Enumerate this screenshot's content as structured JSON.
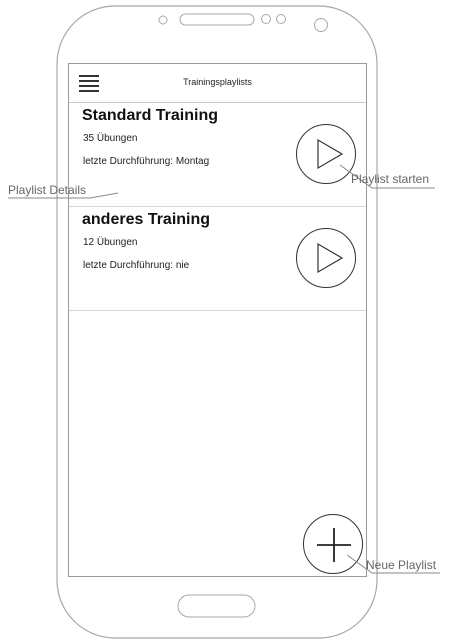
{
  "appbar": {
    "title": "Trainingsplaylists",
    "menu_icon": "hamburger-menu-icon"
  },
  "playlists": [
    {
      "title": "Standard Training",
      "count": "35 Übungen",
      "last_run": "letzte Durchführung: Montag",
      "play_icon": "play-icon"
    },
    {
      "title": "anderes Training",
      "count": "12 Übungen",
      "last_run": "letzte Durchführung: nie",
      "play_icon": "play-icon"
    }
  ],
  "fab": {
    "icon": "plus-icon"
  },
  "annotations": {
    "details": "Playlist Details",
    "start": "Playlist starten",
    "new": "Neue Playlist"
  },
  "colors": {
    "frame": "#9a9a9a",
    "text": "#222222",
    "annotation": "#666666"
  }
}
